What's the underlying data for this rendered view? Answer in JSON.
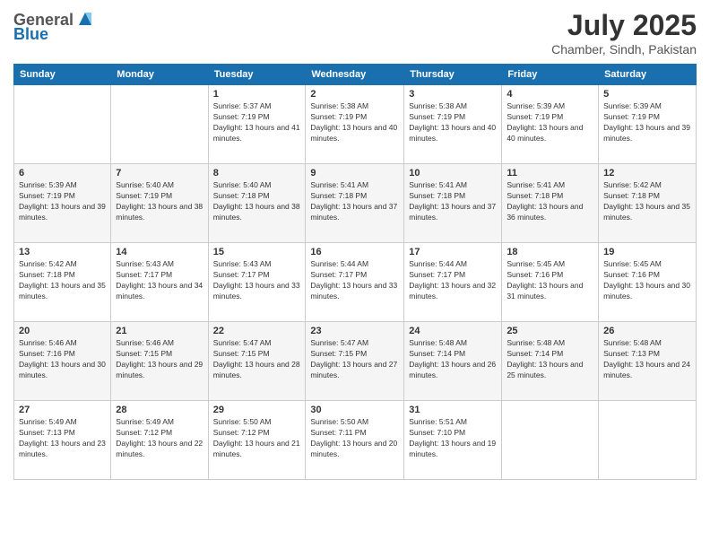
{
  "header": {
    "logo_general": "General",
    "logo_blue": "Blue",
    "title": "July 2025",
    "location": "Chamber, Sindh, Pakistan"
  },
  "days_of_week": [
    "Sunday",
    "Monday",
    "Tuesday",
    "Wednesday",
    "Thursday",
    "Friday",
    "Saturday"
  ],
  "weeks": [
    [
      {
        "day": "",
        "info": ""
      },
      {
        "day": "",
        "info": ""
      },
      {
        "day": "1",
        "info": "Sunrise: 5:37 AM\nSunset: 7:19 PM\nDaylight: 13 hours and 41 minutes."
      },
      {
        "day": "2",
        "info": "Sunrise: 5:38 AM\nSunset: 7:19 PM\nDaylight: 13 hours and 40 minutes."
      },
      {
        "day": "3",
        "info": "Sunrise: 5:38 AM\nSunset: 7:19 PM\nDaylight: 13 hours and 40 minutes."
      },
      {
        "day": "4",
        "info": "Sunrise: 5:39 AM\nSunset: 7:19 PM\nDaylight: 13 hours and 40 minutes."
      },
      {
        "day": "5",
        "info": "Sunrise: 5:39 AM\nSunset: 7:19 PM\nDaylight: 13 hours and 39 minutes."
      }
    ],
    [
      {
        "day": "6",
        "info": "Sunrise: 5:39 AM\nSunset: 7:19 PM\nDaylight: 13 hours and 39 minutes."
      },
      {
        "day": "7",
        "info": "Sunrise: 5:40 AM\nSunset: 7:19 PM\nDaylight: 13 hours and 38 minutes."
      },
      {
        "day": "8",
        "info": "Sunrise: 5:40 AM\nSunset: 7:18 PM\nDaylight: 13 hours and 38 minutes."
      },
      {
        "day": "9",
        "info": "Sunrise: 5:41 AM\nSunset: 7:18 PM\nDaylight: 13 hours and 37 minutes."
      },
      {
        "day": "10",
        "info": "Sunrise: 5:41 AM\nSunset: 7:18 PM\nDaylight: 13 hours and 37 minutes."
      },
      {
        "day": "11",
        "info": "Sunrise: 5:41 AM\nSunset: 7:18 PM\nDaylight: 13 hours and 36 minutes."
      },
      {
        "day": "12",
        "info": "Sunrise: 5:42 AM\nSunset: 7:18 PM\nDaylight: 13 hours and 35 minutes."
      }
    ],
    [
      {
        "day": "13",
        "info": "Sunrise: 5:42 AM\nSunset: 7:18 PM\nDaylight: 13 hours and 35 minutes."
      },
      {
        "day": "14",
        "info": "Sunrise: 5:43 AM\nSunset: 7:17 PM\nDaylight: 13 hours and 34 minutes."
      },
      {
        "day": "15",
        "info": "Sunrise: 5:43 AM\nSunset: 7:17 PM\nDaylight: 13 hours and 33 minutes."
      },
      {
        "day": "16",
        "info": "Sunrise: 5:44 AM\nSunset: 7:17 PM\nDaylight: 13 hours and 33 minutes."
      },
      {
        "day": "17",
        "info": "Sunrise: 5:44 AM\nSunset: 7:17 PM\nDaylight: 13 hours and 32 minutes."
      },
      {
        "day": "18",
        "info": "Sunrise: 5:45 AM\nSunset: 7:16 PM\nDaylight: 13 hours and 31 minutes."
      },
      {
        "day": "19",
        "info": "Sunrise: 5:45 AM\nSunset: 7:16 PM\nDaylight: 13 hours and 30 minutes."
      }
    ],
    [
      {
        "day": "20",
        "info": "Sunrise: 5:46 AM\nSunset: 7:16 PM\nDaylight: 13 hours and 30 minutes."
      },
      {
        "day": "21",
        "info": "Sunrise: 5:46 AM\nSunset: 7:15 PM\nDaylight: 13 hours and 29 minutes."
      },
      {
        "day": "22",
        "info": "Sunrise: 5:47 AM\nSunset: 7:15 PM\nDaylight: 13 hours and 28 minutes."
      },
      {
        "day": "23",
        "info": "Sunrise: 5:47 AM\nSunset: 7:15 PM\nDaylight: 13 hours and 27 minutes."
      },
      {
        "day": "24",
        "info": "Sunrise: 5:48 AM\nSunset: 7:14 PM\nDaylight: 13 hours and 26 minutes."
      },
      {
        "day": "25",
        "info": "Sunrise: 5:48 AM\nSunset: 7:14 PM\nDaylight: 13 hours and 25 minutes."
      },
      {
        "day": "26",
        "info": "Sunrise: 5:48 AM\nSunset: 7:13 PM\nDaylight: 13 hours and 24 minutes."
      }
    ],
    [
      {
        "day": "27",
        "info": "Sunrise: 5:49 AM\nSunset: 7:13 PM\nDaylight: 13 hours and 23 minutes."
      },
      {
        "day": "28",
        "info": "Sunrise: 5:49 AM\nSunset: 7:12 PM\nDaylight: 13 hours and 22 minutes."
      },
      {
        "day": "29",
        "info": "Sunrise: 5:50 AM\nSunset: 7:12 PM\nDaylight: 13 hours and 21 minutes."
      },
      {
        "day": "30",
        "info": "Sunrise: 5:50 AM\nSunset: 7:11 PM\nDaylight: 13 hours and 20 minutes."
      },
      {
        "day": "31",
        "info": "Sunrise: 5:51 AM\nSunset: 7:10 PM\nDaylight: 13 hours and 19 minutes."
      },
      {
        "day": "",
        "info": ""
      },
      {
        "day": "",
        "info": ""
      }
    ]
  ]
}
